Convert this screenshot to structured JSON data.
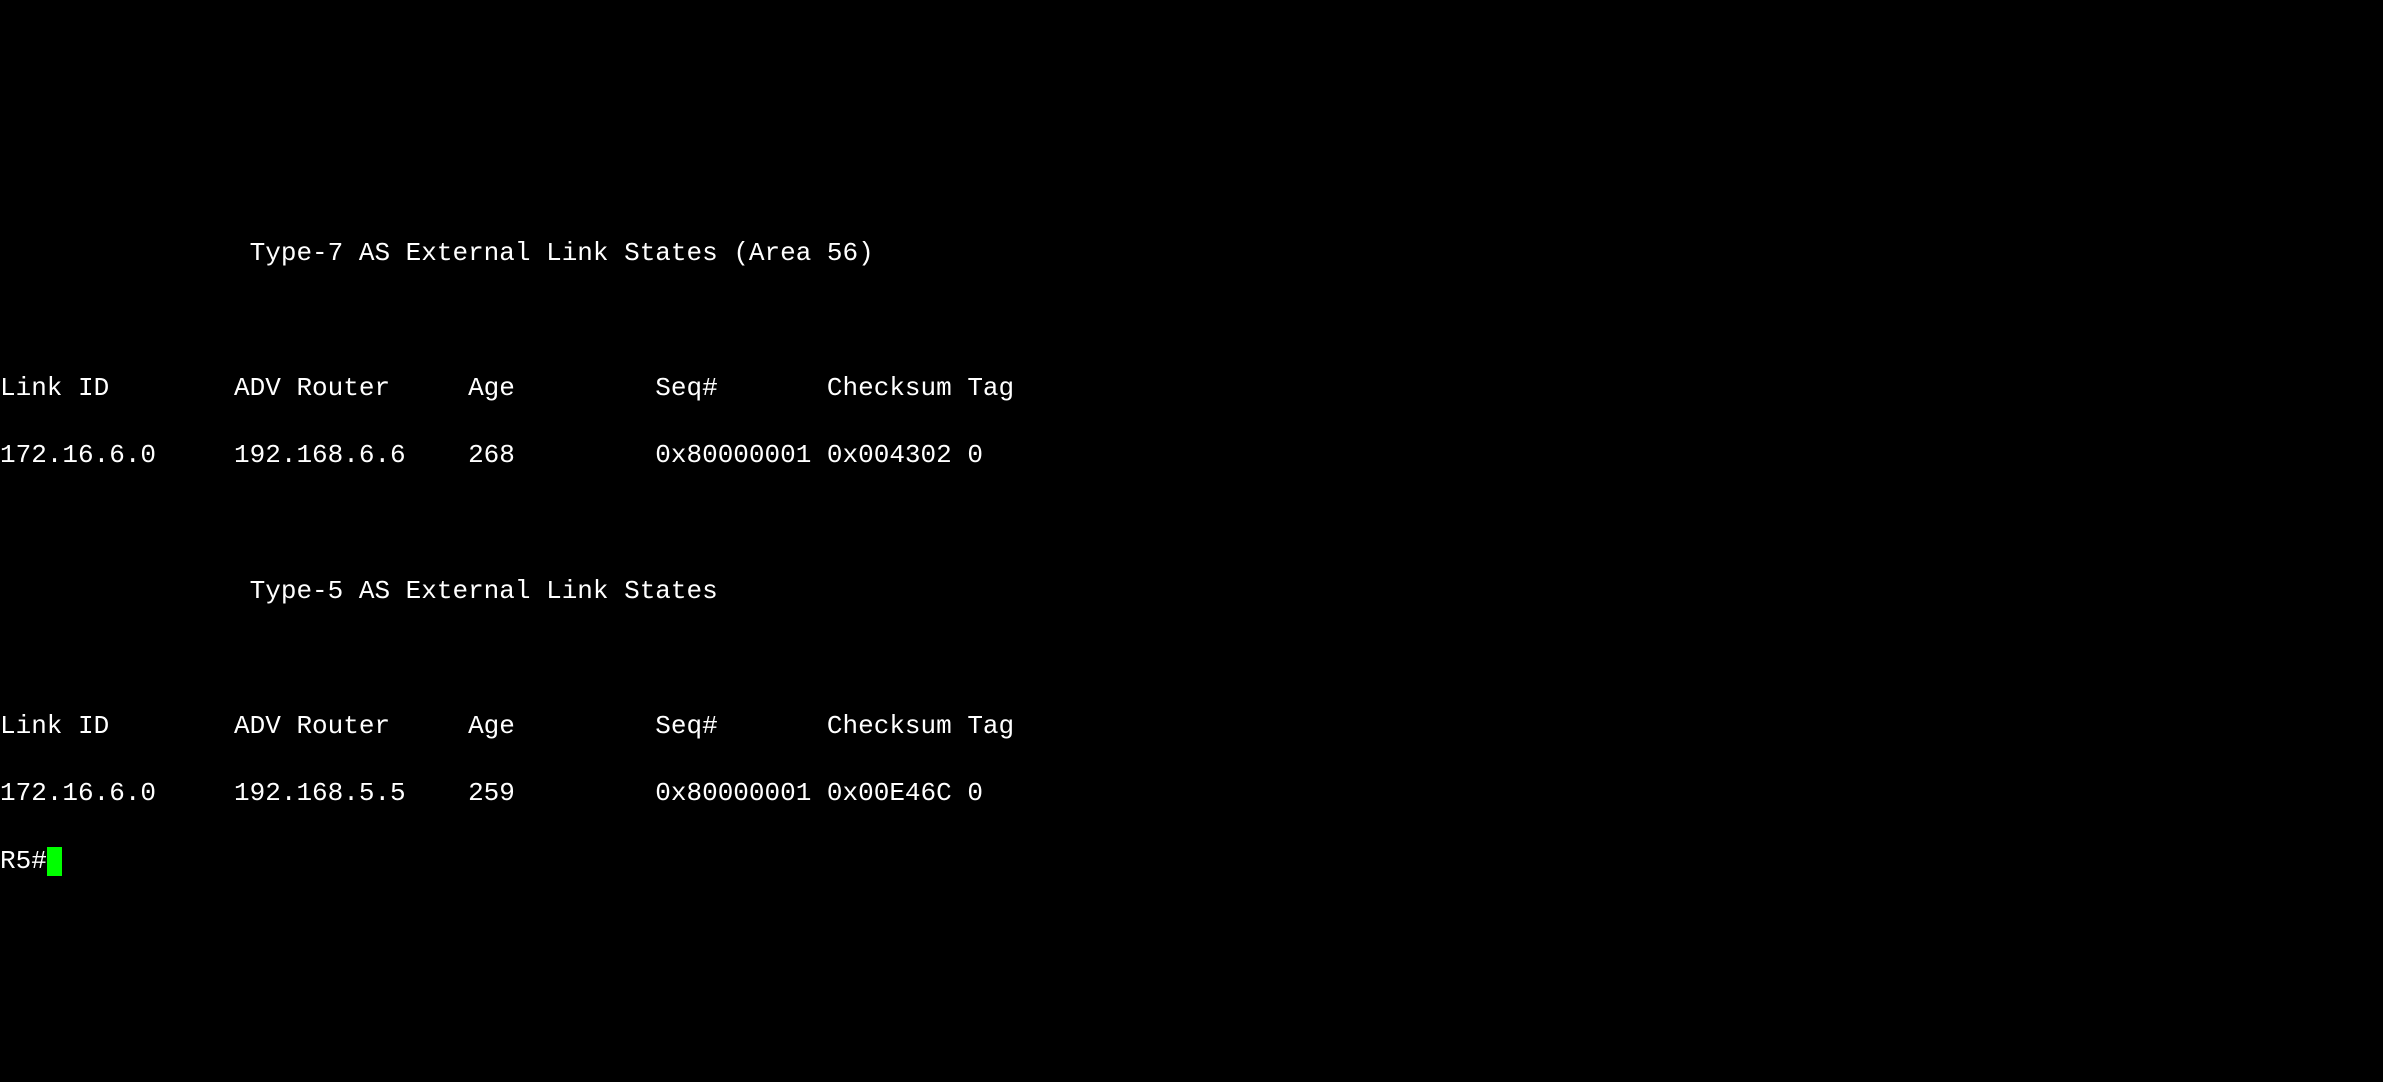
{
  "sections": [
    {
      "title": "Type-7 AS External Link States (Area 56)",
      "headers": {
        "link_id": "Link ID",
        "adv_router": "ADV Router",
        "age": "Age",
        "seq": "Seq#",
        "checksum": "Checksum",
        "tag": "Tag"
      },
      "rows": [
        {
          "link_id": "172.16.6.0",
          "adv_router": "192.168.6.6",
          "age": "268",
          "seq": "0x80000001",
          "checksum": "0x004302",
          "tag": "0"
        }
      ]
    },
    {
      "title": "Type-5 AS External Link States",
      "headers": {
        "link_id": "Link ID",
        "adv_router": "ADV Router",
        "age": "Age",
        "seq": "Seq#",
        "checksum": "Checksum",
        "tag": "Tag"
      },
      "rows": [
        {
          "link_id": "172.16.6.0",
          "adv_router": "192.168.5.5",
          "age": "259",
          "seq": "0x80000001",
          "checksum": "0x00E46C",
          "tag": "0"
        }
      ]
    }
  ],
  "prompt": "R5#"
}
